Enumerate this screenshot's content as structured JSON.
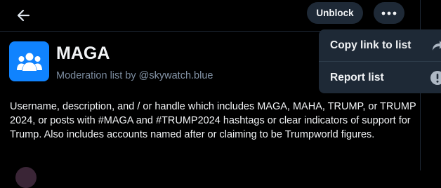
{
  "header": {
    "unblock_label": "Unblock"
  },
  "list": {
    "title": "MAGA",
    "subtitle_prefix": "Moderation list by",
    "handle": "@skywatch.blue",
    "description": "Username, description, and / or handle which includes MAGA, MAHA, TRUMP, or TRUMP 2024, or posts with #MAGA and #TRUMP2024 hashtags or clear indicators of support for Trump. Also includes accounts named after or claiming to be Trumpworld figures."
  },
  "menu": {
    "items": [
      {
        "label": "Copy link to list",
        "icon": "share-arrow-icon"
      },
      {
        "label": "Report list",
        "icon": "alert-circle-icon"
      }
    ]
  },
  "colors": {
    "background": "#000000",
    "accent": "#1083fe",
    "surface": "#1e2936",
    "muted_text": "#7b8b9e"
  }
}
